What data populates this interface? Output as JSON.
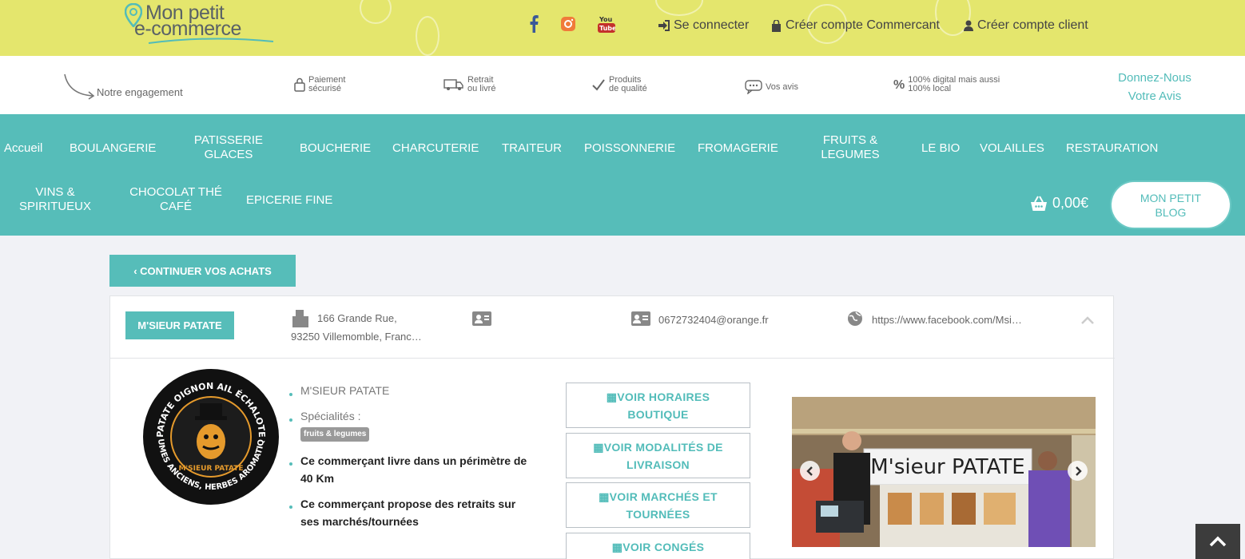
{
  "brand": {
    "line1": "Mon petit",
    "line2": "e-commerce"
  },
  "social": [
    "facebook-icon",
    "instagram-icon",
    "youtube-icon"
  ],
  "top_links": {
    "login": "Se connecter",
    "merchant": "Créer compte Commercant",
    "client": "Créer compte client"
  },
  "features": {
    "engagement": "Notre engagement",
    "payment": [
      "Paiement",
      "sécurisé"
    ],
    "pickup": [
      "Retrait",
      "ou livré"
    ],
    "quality": [
      "Produits",
      "de qualité"
    ],
    "reviews": "Vos avis",
    "digital": [
      "100% digital mais aussi",
      "100% local"
    ],
    "donnez": [
      "Donnez-Nous",
      "Votre Avis"
    ]
  },
  "nav": {
    "row1": [
      "Accueil",
      "BOULANGERIE",
      "PATISSERIE|GLACES",
      "BOUCHERIE",
      "CHARCUTERIE",
      "TRAITEUR",
      "POISSONNERIE",
      "FROMAGERIE",
      "FRUITS &|LEGUMES",
      "LE BIO",
      "VOLAILLES",
      "RESTAURATION"
    ],
    "row2": [
      "VINS &|SPIRITUEUX",
      "CHOCOLAT THÉ|CAFÉ",
      "EPICERIE FINE"
    ],
    "cart_total": "0,00€",
    "blog": [
      "MON PETIT",
      "BLOG"
    ]
  },
  "continue_label": "‹ CONTINUER VOS ACHATS",
  "shop": {
    "name_badge": "M'SIEUR PATATE",
    "address_line1": "166 Grande Rue,",
    "address_line2": "93250 Villemomble, Franc…",
    "email": "0672732404@orange.fr",
    "website": "https://www.facebook.com/Msi…",
    "name": "M'SIEUR PATATE",
    "specialites_label": "Spécialités :",
    "tag": "fruits & legumes",
    "delivery_line1": "Ce commerçant livre dans un périmètre de",
    "delivery_line2": "40 Km",
    "pickup_line1": "Ce commerçant propose des retraits sur",
    "pickup_line2": "ses marchés/tournées",
    "logo_text_top": "PATATE OIGNON AIL ÉCHALOTE",
    "logo_text_bottom": "LEGUMES ANCIENS, HERBES AROMATIQUES",
    "logo_center": "M'SIEUR PATATE",
    "photo_banner": "M'sieur PATATE"
  },
  "buttons": [
    [
      "VOIR HORAIRES",
      "BOUTIQUE"
    ],
    [
      "VOIR MODALITÉS DE",
      "LIVRAISON"
    ],
    [
      "VOIR MARCHÉS ET",
      "TOURNÉES"
    ],
    [
      "VOIR CONGÉS",
      ""
    ]
  ],
  "colors": {
    "teal": "#56bdb9",
    "yellow": "#e4e66d"
  }
}
